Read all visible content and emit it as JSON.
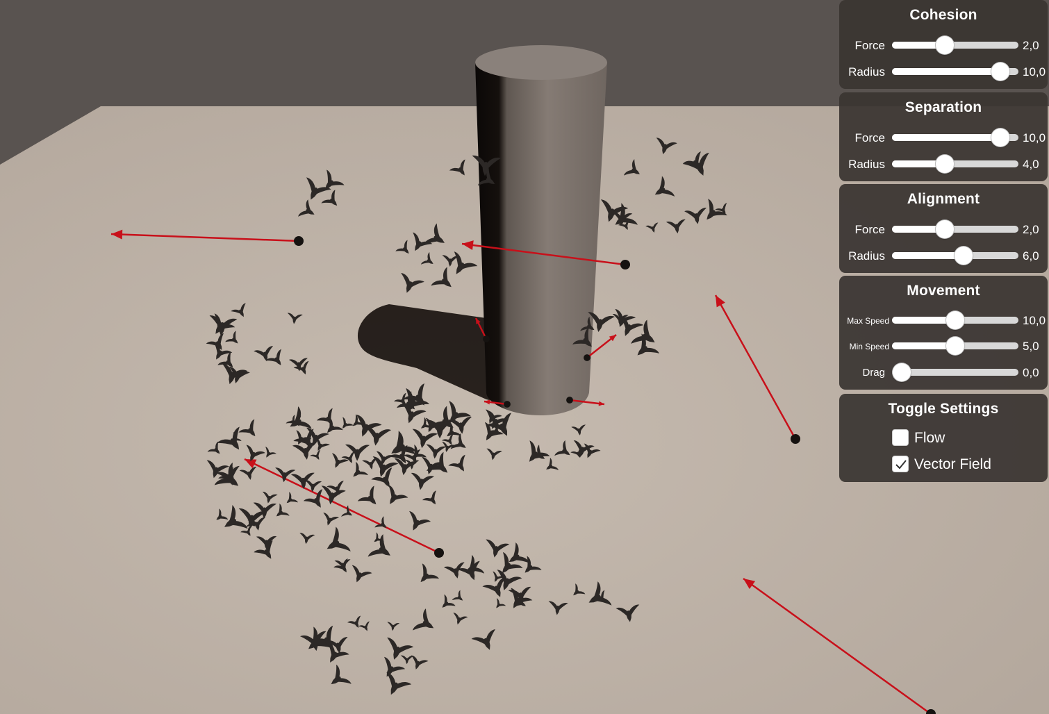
{
  "scene": {
    "sky_color": "#595350",
    "ground_color": "#b8aca1",
    "obstacle_color": "#7d746d",
    "vector_color": "#c8101a"
  },
  "settings": {
    "cohesion": {
      "title": "Cohesion",
      "force": {
        "label": "Force",
        "value": "2,0",
        "level": 0.4
      },
      "radius": {
        "label": "Radius",
        "value": "10,0",
        "level": 0.92
      }
    },
    "separation": {
      "title": "Separation",
      "force": {
        "label": "Force",
        "value": "10,0",
        "level": 0.92
      },
      "radius": {
        "label": "Radius",
        "value": "4,0",
        "level": 0.4
      }
    },
    "alignment": {
      "title": "Alignment",
      "force": {
        "label": "Force",
        "value": "2,0",
        "level": 0.4
      },
      "radius": {
        "label": "Radius",
        "value": "6,0",
        "level": 0.58
      }
    },
    "movement": {
      "title": "Movement",
      "max_speed": {
        "label": "Max Speed",
        "value": "10,0",
        "level": 0.5
      },
      "min_speed": {
        "label": "Min Speed",
        "value": "5,0",
        "level": 0.5
      },
      "drag": {
        "label": "Drag",
        "value": "0,0",
        "level": 0.0
      }
    },
    "toggles": {
      "title": "Toggle Settings",
      "flow": {
        "label": "Flow",
        "checked": false
      },
      "vector_field": {
        "label": "Vector Field",
        "checked": true
      }
    }
  }
}
